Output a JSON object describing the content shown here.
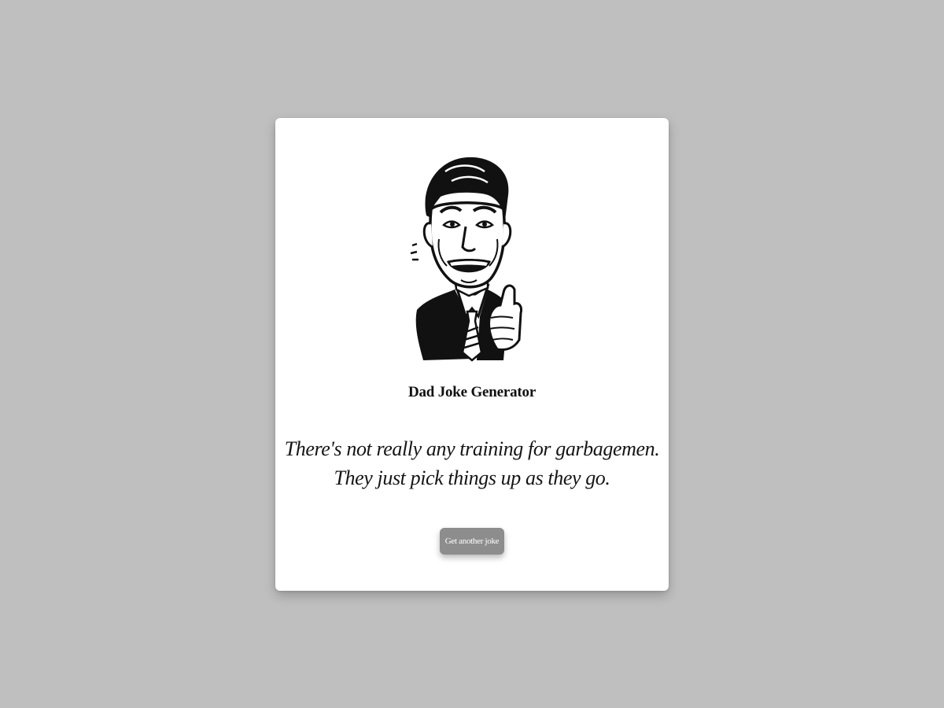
{
  "app": {
    "title": "Dad Joke Generator"
  },
  "joke": {
    "line1": "There's not really any training for garbagemen.",
    "line2": "They just pick things up as they go."
  },
  "actions": {
    "next_label": "Get another joke"
  },
  "illustration": {
    "icon": "smiling-dad-thumbs-up-illustration"
  },
  "colors": {
    "background": "#bfbfbf",
    "card": "#ffffff",
    "button": "#8d8d8d",
    "text": "#111111"
  }
}
